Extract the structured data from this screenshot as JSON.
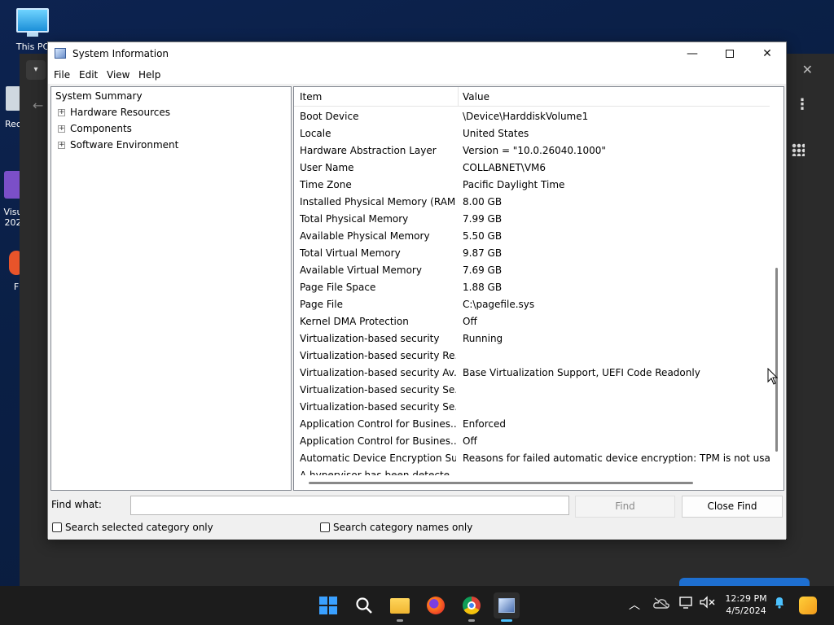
{
  "desktop": {
    "icons": [
      {
        "label": "This PC"
      },
      {
        "label": "Rec"
      },
      {
        "label": "Visu 202"
      },
      {
        "label": "F"
      }
    ]
  },
  "window": {
    "title": "System Information",
    "controls": {
      "minimize": "—",
      "close": "✕"
    },
    "menu": [
      "File",
      "Edit",
      "View",
      "Help"
    ]
  },
  "tree": {
    "root": "System Summary",
    "children": [
      "Hardware Resources",
      "Components",
      "Software Environment"
    ]
  },
  "list": {
    "headers": {
      "item": "Item",
      "value": "Value"
    },
    "rows": [
      [
        "Boot Device",
        "\\Device\\HarddiskVolume1"
      ],
      [
        "Locale",
        "United States"
      ],
      [
        "Hardware Abstraction Layer",
        "Version = \"10.0.26040.1000\""
      ],
      [
        "User Name",
        "COLLABNET\\VM6"
      ],
      [
        "Time Zone",
        "Pacific Daylight Time"
      ],
      [
        "Installed Physical Memory (RAM)",
        "8.00 GB"
      ],
      [
        "Total Physical Memory",
        "7.99 GB"
      ],
      [
        "Available Physical Memory",
        "5.50 GB"
      ],
      [
        "Total Virtual Memory",
        "9.87 GB"
      ],
      [
        "Available Virtual Memory",
        "7.69 GB"
      ],
      [
        "Page File Space",
        "1.88 GB"
      ],
      [
        "Page File",
        "C:\\pagefile.sys"
      ],
      [
        "Kernel DMA Protection",
        "Off"
      ],
      [
        "Virtualization-based security",
        "Running"
      ],
      [
        "Virtualization-based security Re...",
        ""
      ],
      [
        "Virtualization-based security Av...",
        "Base Virtualization Support, UEFI Code Readonly"
      ],
      [
        "Virtualization-based security Se...",
        ""
      ],
      [
        "Virtualization-based security Se...",
        ""
      ],
      [
        "Application Control for Busines...",
        "Enforced"
      ],
      [
        "Application Control for Busines...",
        "Off"
      ],
      [
        "Automatic Device Encryption Su...",
        "Reasons for failed automatic device encryption: TPM is not usabl"
      ],
      [
        "A hypervisor has been detecte...",
        ""
      ]
    ]
  },
  "find": {
    "label": "Find what:",
    "value": "",
    "placeholder": "",
    "find_button": "Find",
    "close_button": "Close Find",
    "check_selected": "Search selected category only",
    "check_names": "Search category names only"
  },
  "taskbar": {
    "time": "12:29 PM",
    "date": "4/5/2024",
    "icons": [
      "start-icon",
      "search-icon",
      "file-explorer-icon",
      "firefox-icon",
      "chrome-icon",
      "system-information-icon"
    ]
  },
  "colors": {
    "accent": "#4cc2ff",
    "taskbar": "#1c1c1c"
  }
}
